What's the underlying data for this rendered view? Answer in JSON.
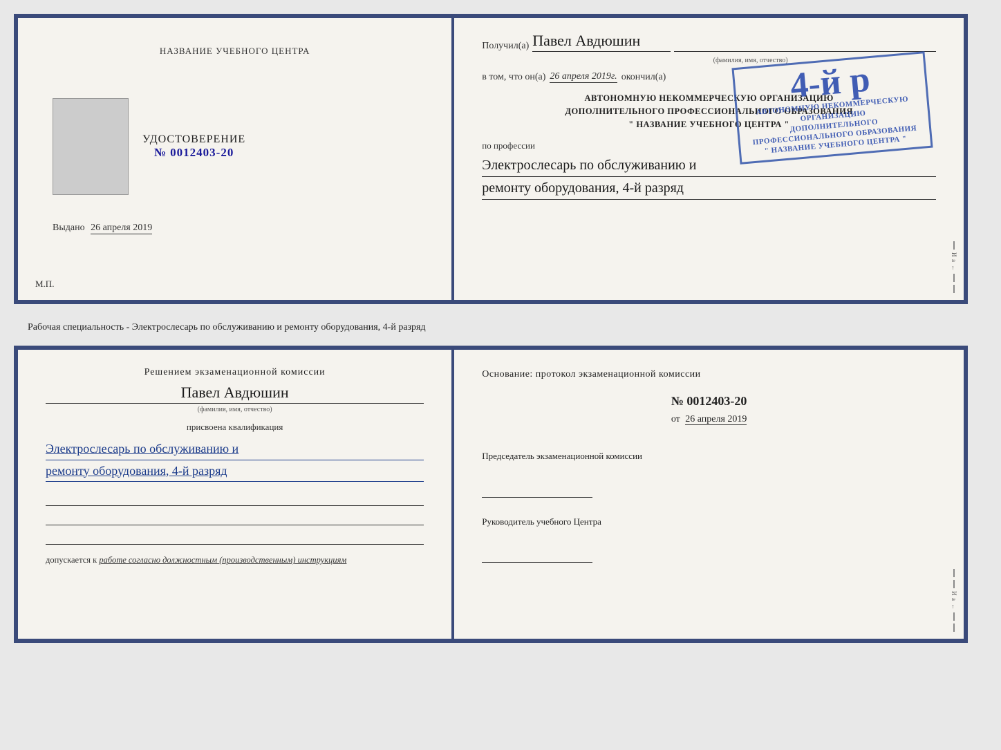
{
  "topDoc": {
    "leftPanel": {
      "centerTitle": "НАЗВАНИЕ УЧЕБНОГО ЦЕНТРА",
      "udostoverenie": "УДОСТОВЕРЕНИЕ",
      "docNumber": "№ 0012403-20",
      "vydanoLabel": "Выдано",
      "vydanoDate": "26 апреля 2019",
      "mpLabel": "М.П."
    },
    "rightPanel": {
      "poluchilLabel": "Получил(а)",
      "recipientName": "Павел Авдюшин",
      "fioSubtitle": "(фамилия, имя, отчество)",
      "vtomChtoLabel": "в том, что он(а)",
      "completionDate": "26 апреля 2019г.",
      "okonchilLabel": "окончил(а)",
      "stampNumber": "4-й р",
      "orgLine1": "АВТОНОМНУЮ НЕКОММЕРЧЕСКУЮ ОРГАНИЗАЦИЮ",
      "orgLine2": "ДОПОЛНИТЕЛЬНОГО ПРОФЕССИОНАЛЬНОГО ОБРАЗОВАНИЯ",
      "orgLine3": "\" НАЗВАНИЕ УЧЕБНОГО ЦЕНТРА \"",
      "professionLabel": "по профессии",
      "professionLine1": "Электрослесарь по обслуживанию и",
      "professionLine2": "ремонту оборудования, 4-й разряд"
    }
  },
  "middleText": "Рабочая специальность - Электрослесарь по обслуживанию и ремонту оборудования, 4-й разряд",
  "bottomDoc": {
    "leftPanel": {
      "resheniemTitle": "Решением экзаменационной комиссии",
      "personName": "Павел Авдюшин",
      "fioSubtitle": "(фамилия, имя, отчество)",
      "prisvoenaText": "присвоена квалификация",
      "qualificationLine1": "Электрослесарь по обслуживанию и",
      "qualificationLine2": "ремонту оборудования, 4-й разряд",
      "dopuskaetsyaLabel": "допускается к",
      "dopuskaetsyaText": "работе согласно должностным (производственным) инструкциям"
    },
    "rightPanel": {
      "osnovanieTitleLine1": "Основание: протокол экзаменационной комиссии",
      "protocolNumber": "№  0012403-20",
      "otLabel": "от",
      "otDate": "26 апреля 2019",
      "predsedatelLabel": "Председатель экзаменационной комиссии",
      "rukovoditelLabel": "Руководитель учебного Центра"
    }
  },
  "spineChars": [
    "И",
    "а",
    "←",
    "–",
    "–",
    "–",
    "–",
    "–"
  ]
}
